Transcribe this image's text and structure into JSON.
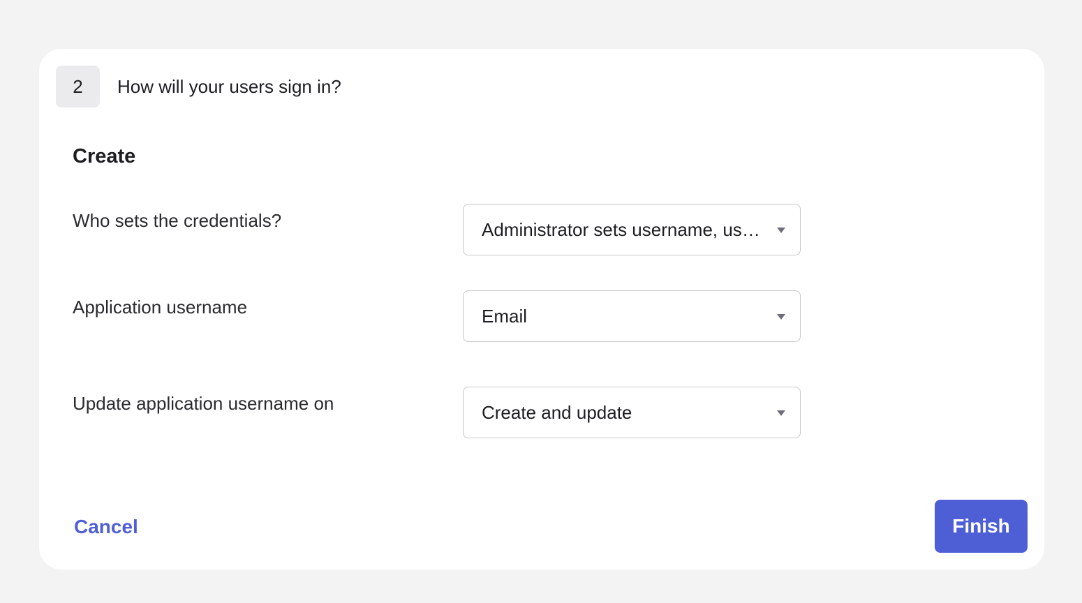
{
  "step": {
    "number": "2",
    "title": "How will your users sign in?"
  },
  "section": {
    "title": "Create"
  },
  "fields": [
    {
      "label": "Who sets the credentials?",
      "value": "Administrator sets username, user sets password"
    },
    {
      "label": "Application username",
      "value": "Email"
    },
    {
      "label": "Update application username on",
      "value": "Create and update"
    }
  ],
  "actions": {
    "cancel_label": "Cancel",
    "finish_label": "Finish"
  },
  "colors": {
    "accent": "#4e5fd6",
    "link": "#4f5fd5",
    "background": "#f3f3f3",
    "card": "#ffffff"
  },
  "icons": {
    "dropdown": "caret-down-icon"
  }
}
